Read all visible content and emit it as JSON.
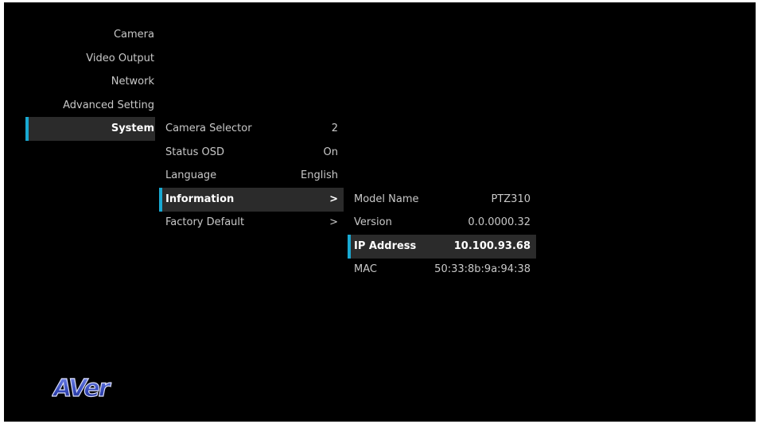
{
  "main_menu": {
    "items": [
      {
        "label": "Camera"
      },
      {
        "label": "Video Output"
      },
      {
        "label": "Network"
      },
      {
        "label": "Advanced Setting"
      },
      {
        "label": "System"
      }
    ]
  },
  "system_menu": {
    "items": [
      {
        "label": "Camera Selector",
        "value": "2"
      },
      {
        "label": "Status OSD",
        "value": "On"
      },
      {
        "label": "Language",
        "value": "English"
      },
      {
        "label": "Information",
        "value": ">"
      },
      {
        "label": "Factory Default",
        "value": ">"
      }
    ]
  },
  "information_panel": {
    "items": [
      {
        "label": "Model Name",
        "value": "PTZ310"
      },
      {
        "label": "Version",
        "value": "0.0.0000.32"
      },
      {
        "label": "IP Address",
        "value": "10.100.93.68"
      },
      {
        "label": "MAC",
        "value": "50:33:8b:9a:94:38"
      }
    ]
  },
  "logo": {
    "text": "AVer"
  },
  "colors": {
    "background": "#000000",
    "selection_accent": "#19a9d2",
    "selection_bg": "#2b2b2b",
    "text": "#c8c8c8",
    "logo_fill": "#3a4fc0"
  }
}
